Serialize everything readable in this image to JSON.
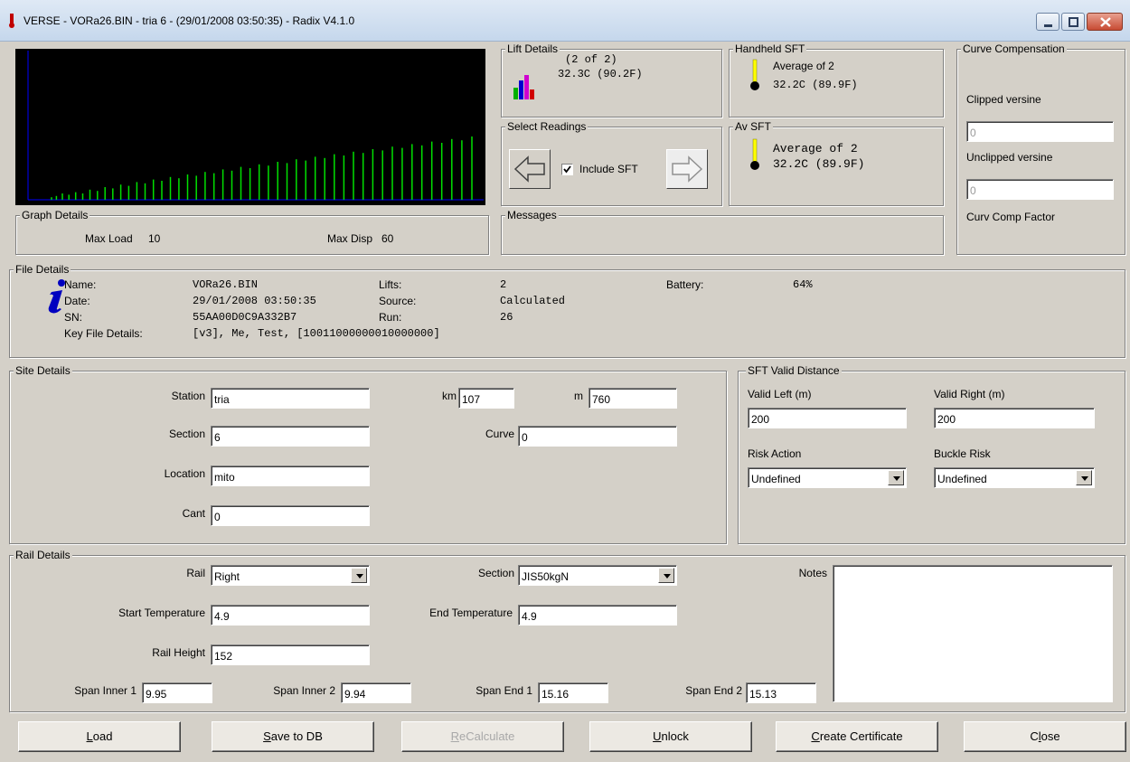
{
  "window": {
    "title": "VERSE - VORa26.BIN - tria 6 - (29/01/2008 03:50:35) - Radix V4.1.0"
  },
  "graph_details": {
    "label": "Graph Details",
    "max_load_label": "Max Load",
    "max_load_value": "10",
    "max_disp_label": "Max Disp",
    "max_disp_value": "60"
  },
  "lift_details": {
    "label": "Lift Details",
    "count": "(2 of 2)",
    "temp": "32.3C (90.2F)",
    "icon": "bar-chart-icon"
  },
  "handheld_sft": {
    "label": "Handheld SFT",
    "line1": "Average of 2",
    "line2": "32.2C (89.9F)",
    "icon": "thermometer-icon"
  },
  "av_sft": {
    "label": "Av SFT",
    "line1": "Average of 2",
    "line2": "32.2C (89.9F)",
    "icon": "thermometer-icon"
  },
  "select_readings": {
    "label": "Select Readings",
    "include_sft_label": "Include SFT",
    "include_sft_checked": true,
    "prev_icon": "left-arrow-icon",
    "next_icon": "right-arrow-icon"
  },
  "messages": {
    "label": "Messages"
  },
  "curve_compensation": {
    "label": "Curve Compensation",
    "clipped_label": "Clipped versine",
    "clipped_value": "0",
    "unclipped_label": "Unclipped versine",
    "unclipped_value": "0",
    "factor_label": "Curv Comp Factor"
  },
  "file_details": {
    "label": "File Details",
    "icon": "info-icon",
    "name_label": "Name:",
    "name_value": "VORa26.BIN",
    "date_label": "Date:",
    "date_value": "29/01/2008 03:50:35",
    "sn_label": "SN:",
    "sn_value": "55AA00D0C9A332B7",
    "key_label": "Key File Details:",
    "key_value": "[v3], Me, Test, [10011000000010000000]",
    "lifts_label": "Lifts:",
    "lifts_value": "2",
    "source_label": "Source:",
    "source_value": "Calculated",
    "run_label": "Run:",
    "run_value": "26",
    "battery_label": "Battery:",
    "battery_value": "64%"
  },
  "site_details": {
    "label": "Site Details",
    "station_label": "Station",
    "station_value": "tria",
    "section_label": "Section",
    "section_value": "6",
    "location_label": "Location",
    "location_value": "mito",
    "cant_label": "Cant",
    "cant_value": "0",
    "km_label": "km",
    "km_value": "107",
    "m_label": "m",
    "m_value": "760",
    "curve_label": "Curve",
    "curve_value": "0"
  },
  "sft_valid_distance": {
    "label": "SFT Valid Distance",
    "valid_left_label": "Valid Left (m)",
    "valid_left_value": "200",
    "valid_right_label": "Valid Right (m)",
    "valid_right_value": "200",
    "risk_action_label": "Risk Action",
    "risk_action_value": "Undefined",
    "buckle_risk_label": "Buckle Risk",
    "buckle_risk_value": "Undefined"
  },
  "rail_details": {
    "label": "Rail Details",
    "rail_label": "Rail",
    "rail_value": "Right",
    "section_label": "Section",
    "section_value": "JIS50kgN",
    "start_temp_label": "Start Temperature",
    "start_temp_value": "4.9",
    "end_temp_label": "End Temperature",
    "end_temp_value": "4.9",
    "rail_height_label": "Rail Height",
    "rail_height_value": "152",
    "notes_label": "Notes",
    "notes_value": "",
    "span_inner1_label": "Span Inner 1",
    "span_inner1_value": "9.95",
    "span_inner2_label": "Span Inner 2",
    "span_inner2_value": "9.94",
    "span_end1_label": "Span End 1",
    "span_end1_value": "15.16",
    "span_end2_label": "Span End 2",
    "span_end2_value": "15.13"
  },
  "buttons": {
    "load_accel": "L",
    "load_rest": "oad",
    "save_accel": "S",
    "save_rest": "ave to DB",
    "recalc_accel": "R",
    "recalc_rest": "eCalculate",
    "unlock_accel": "U",
    "unlock_rest": "nlock",
    "cert_accel": "C",
    "cert_rest": "reate Certificate",
    "close_pre": "C",
    "close_accel": "l",
    "close_rest": "ose"
  },
  "graph": {
    "bars": [
      0.02,
      0.03,
      0.05,
      0.04,
      0.06,
      0.05,
      0.08,
      0.07,
      0.1,
      0.09,
      0.12,
      0.11,
      0.14,
      0.13,
      0.16,
      0.15,
      0.18,
      0.17,
      0.2,
      0.19,
      0.22,
      0.21,
      0.24,
      0.23,
      0.26,
      0.25,
      0.28,
      0.27,
      0.3,
      0.29,
      0.32,
      0.31,
      0.34,
      0.33,
      0.36,
      0.35,
      0.38,
      0.37,
      0.4,
      0.39,
      0.42,
      0.41,
      0.44,
      0.43,
      0.46,
      0.45,
      0.48,
      0.47,
      0.5
    ],
    "bar_color": "#00e000",
    "axis_color": "#0000ff"
  }
}
